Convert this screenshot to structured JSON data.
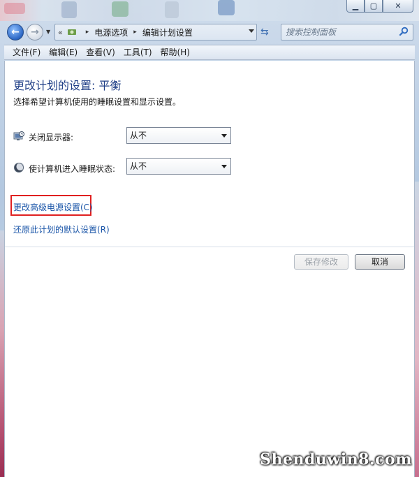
{
  "address_bar": {
    "overflow_chevron": "«",
    "crumbs": [
      "电源选项",
      "编辑计划设置"
    ]
  },
  "search": {
    "placeholder": "搜索控制面板"
  },
  "menu": {
    "items": [
      {
        "label": "文件(F)"
      },
      {
        "label": "编辑(E)"
      },
      {
        "label": "查看(V)"
      },
      {
        "label": "工具(T)"
      },
      {
        "label": "帮助(H)"
      }
    ]
  },
  "main": {
    "title": "更改计划的设置: 平衡",
    "subtitle": "选择希望计算机使用的睡眠设置和显示设置。",
    "settings": [
      {
        "label": "关闭显示器:",
        "value": "从不",
        "icon": "monitor-clock-icon"
      },
      {
        "label": "使计算机进入睡眠状态:",
        "value": "从不",
        "icon": "sleep-moon-icon"
      }
    ],
    "links": {
      "advanced": "更改高级电源设置(C)",
      "restore": "还原此计划的默认设置(R)"
    },
    "buttons": {
      "save": "保存修改",
      "cancel": "取消"
    }
  },
  "watermark": {
    "text": "Shenduwin8.com"
  },
  "colors": {
    "title_blue": "#1f3e86",
    "link_blue": "#1a55a8",
    "highlight_red": "#e02020"
  }
}
